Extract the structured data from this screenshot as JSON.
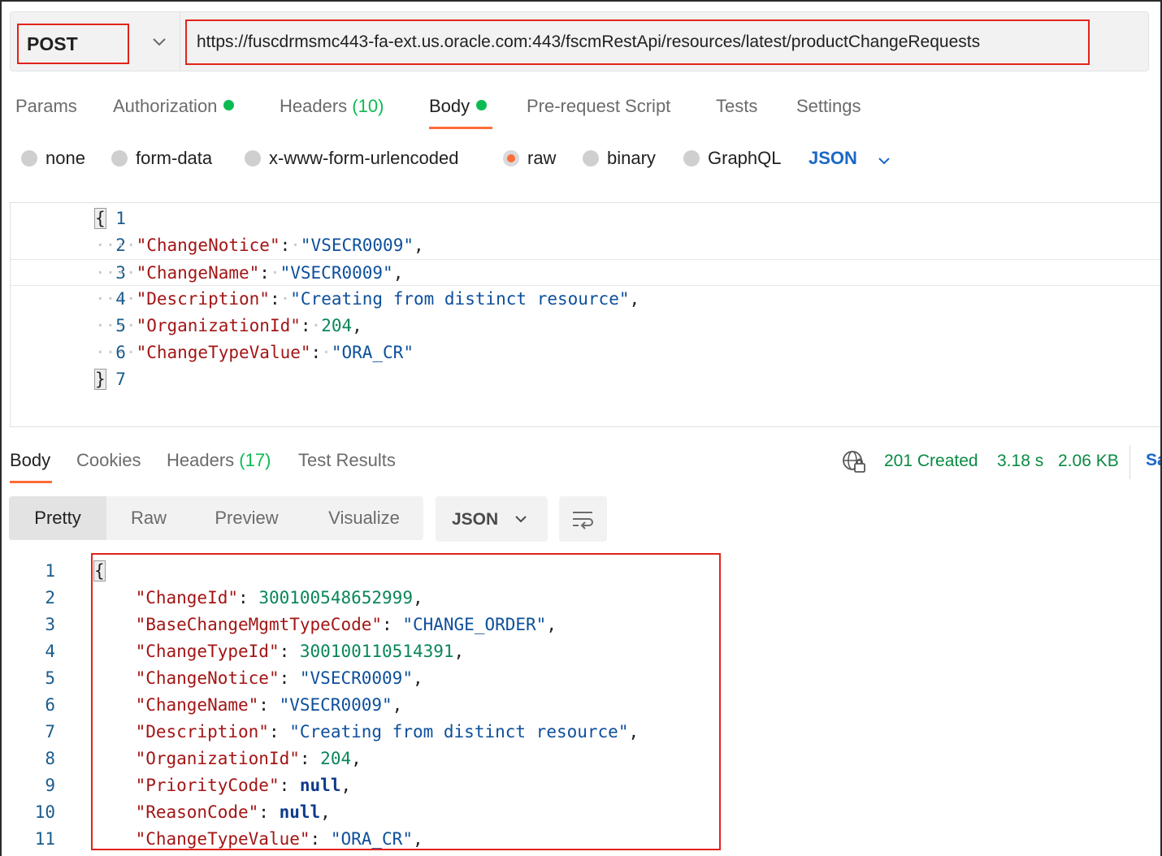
{
  "request": {
    "method": "POST",
    "url": "https://fuscdrmsmc443-fa-ext.us.oracle.com:443/fscmRestApi/resources/latest/productChangeRequests"
  },
  "request_tabs": {
    "params": "Params",
    "authorization": "Authorization",
    "headers": "Headers",
    "headers_count": "(10)",
    "body": "Body",
    "pre_request": "Pre-request Script",
    "tests": "Tests",
    "settings": "Settings"
  },
  "body_types": {
    "none": "none",
    "form_data": "form-data",
    "urlencoded": "x-www-form-urlencoded",
    "raw": "raw",
    "binary": "binary",
    "graphql": "GraphQL",
    "language": "JSON"
  },
  "request_body": {
    "line_numbers": [
      "1",
      "2",
      "3",
      "4",
      "5",
      "6",
      "7"
    ],
    "ChangeNotice": "\"VSECR0009\"",
    "ChangeName": "\"VSECR0009\"",
    "Description": "\"Creating from distinct resource\"",
    "OrganizationId": "204",
    "ChangeTypeValue": "\"ORA_CR\""
  },
  "response_tabs": {
    "body": "Body",
    "cookies": "Cookies",
    "headers": "Headers",
    "headers_count": "(17)",
    "test_results": "Test Results"
  },
  "response_status": {
    "status": "201 Created",
    "time": "3.18 s",
    "size": "2.06 KB",
    "save_cut": "Sa"
  },
  "view_modes": {
    "pretty": "Pretty",
    "raw": "Raw",
    "preview": "Preview",
    "visualize": "Visualize",
    "format": "JSON"
  },
  "response_body": {
    "line_numbers": [
      "1",
      "2",
      "3",
      "4",
      "5",
      "6",
      "7",
      "8",
      "9",
      "10",
      "11"
    ],
    "ChangeId": "300100548652999",
    "BaseChangeMgmtTypeCode": "\"CHANGE_ORDER\"",
    "ChangeTypeId": "300100110514391",
    "ChangeNotice": "\"VSECR0009\"",
    "ChangeName": "\"VSECR0009\"",
    "Description": "\"Creating from distinct resource\"",
    "OrganizationId": "204",
    "PriorityCode": "null",
    "ReasonCode": "null",
    "ChangeTypeValue": "\"ORA_CR\""
  },
  "colors": {
    "accent": "#ff6c37",
    "success": "#0cbb52",
    "link": "#1a68c7",
    "highlight_box": "#e2231a",
    "json_key": "#a31515",
    "json_string": "#0d4f9b",
    "json_number": "#098658"
  }
}
